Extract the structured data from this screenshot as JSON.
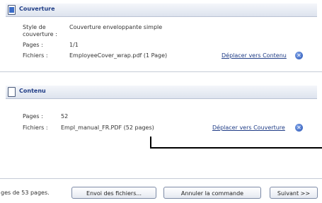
{
  "couverture": {
    "title": "Couverture",
    "style_label_1": "Style de",
    "style_label_2": "couverture :",
    "style_value": "Couverture enveloppante simple",
    "pages_label": "Pages :",
    "pages_value": "1/1",
    "files_label": "Fichiers :",
    "file_value": "EmployeeCover_wrap.pdf (1 Page)",
    "move_link": "Déplacer vers Contenu"
  },
  "contenu": {
    "title": "Contenu",
    "pages_label": "Pages :",
    "pages_value": "52",
    "files_label": "Fichiers :",
    "file_value": "Empl_manual_FR.PDF (52 pages)",
    "move_link": "Déplacer vers Couverture"
  },
  "footer": {
    "status_text": "ges de 53 pages.",
    "send_files_label": "Envoi des fichiers...",
    "cancel_label": "Annuler la commande",
    "next_label": "Suivant >>"
  },
  "icons": {
    "section_icon": "document-icon",
    "remove_icon": "remove-x-icon"
  },
  "colors": {
    "accent": "#1f3c86",
    "icon_blue": "#2a55b5"
  }
}
